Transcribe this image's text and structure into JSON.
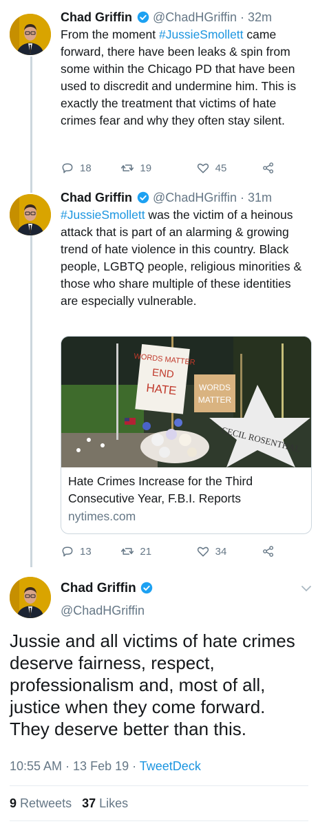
{
  "tweets": [
    {
      "name": "Chad Griffin",
      "handle": "@ChadHGriffin",
      "time": "· 32m",
      "text_parts": [
        "",
        "#JussieSmollett",
        ""
      ],
      "text_before": "From the moment ",
      "hashtag": "#JussieSmollett",
      "text_after": " came forward, there have been leaks & spin from some within the Chicago PD that have been used to discredit and undermine him. This is exactly the treatment that victims of hate crimes fear and why they often stay silent.",
      "replies": "18",
      "retweets": "19",
      "likes": "45"
    },
    {
      "name": "Chad Griffin",
      "handle": "@ChadHGriffin",
      "time": "· 31m",
      "hashtag": "#JussieSmollett",
      "text_after": " was the victim of a heinous attack that is part of an alarming & growing trend of hate violence in this country. Black people, LGBTQ people, religious minorities & those who share multiple of these identities are especially vulnerable.",
      "card": {
        "image_signs": [
          "WORDS MATTER",
          "END",
          "HATE",
          "WORDS",
          "MATTER",
          "CECIL ROSENTHAL"
        ],
        "title": "Hate Crimes Increase for the Third Consecutive Year, F.B.I. Reports",
        "domain": "nytimes.com"
      },
      "replies": "13",
      "retweets": "21",
      "likes": "34"
    }
  ],
  "main_tweet": {
    "name": "Chad Griffin",
    "handle": "@ChadHGriffin",
    "text": "Jussie and all victims of hate crimes deserve fairness, respect, professionalism and, most of all, justice when they come forward. They deserve better than this.",
    "time": "10:55 AM · 13 Feb 19 · ",
    "client": "TweetDeck",
    "retweet_count": "9",
    "retweet_label": "Retweets",
    "like_count": "37",
    "like_label": "Likes"
  },
  "colors": {
    "link": "#1b95e0",
    "muted": "#657786",
    "verified": "#1da1f2",
    "avatar_bg": "#d9a400"
  },
  "icons": [
    "reply-icon",
    "retweet-icon",
    "like-icon",
    "share-icon",
    "verified-badge-icon",
    "chevron-down-icon"
  ]
}
